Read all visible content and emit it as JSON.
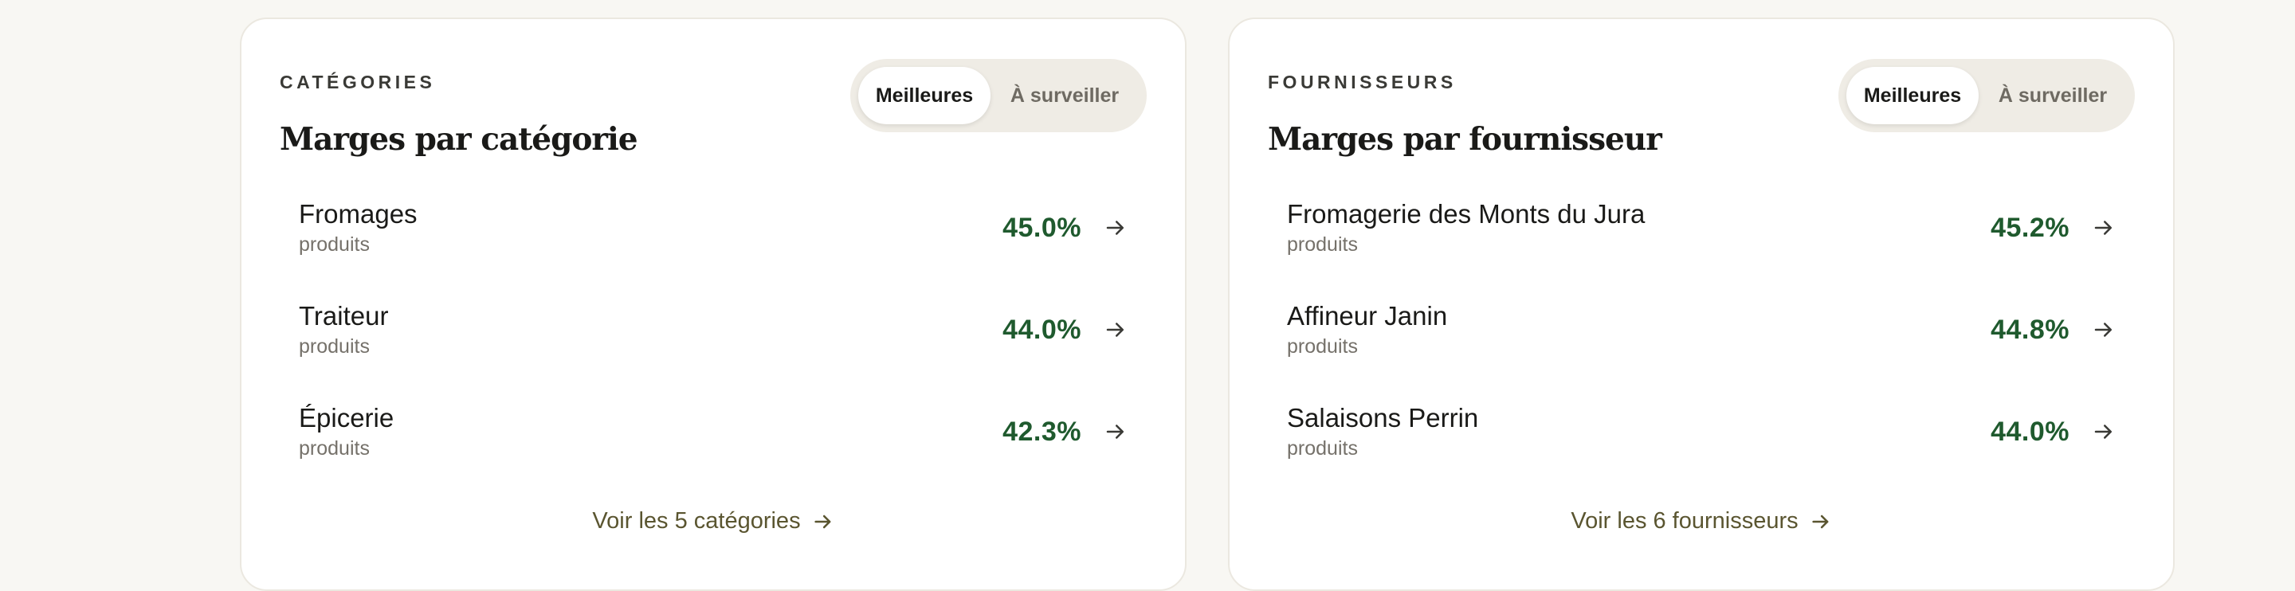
{
  "categories": {
    "eyebrow": "CATÉGORIES",
    "title": "Marges par catégorie",
    "toggle": {
      "active": "Meilleures",
      "inactive": "À surveiller"
    },
    "rows": [
      {
        "name": "Fromages",
        "sub": "produits",
        "value": "45.0%"
      },
      {
        "name": "Traiteur",
        "sub": "produits",
        "value": "44.0%"
      },
      {
        "name": "Épicerie",
        "sub": "produits",
        "value": "42.3%"
      }
    ],
    "footer_link": "Voir les 5 catégories"
  },
  "suppliers": {
    "eyebrow": "FOURNISSEURS",
    "title": "Marges par fournisseur",
    "toggle": {
      "active": "Meilleures",
      "inactive": "À surveiller"
    },
    "rows": [
      {
        "name": "Fromagerie des Monts du Jura",
        "sub": "produits",
        "value": "45.2%"
      },
      {
        "name": "Affineur Janin",
        "sub": "produits",
        "value": "44.8%"
      },
      {
        "name": "Salaisons Perrin",
        "sub": "produits",
        "value": "44.0%"
      }
    ],
    "footer_link": "Voir les 6 fournisseurs"
  },
  "colors": {
    "background": "#f8f7f3",
    "card": "#ffffff",
    "value_green": "#1f5a2e",
    "link_olive": "#5a5530"
  },
  "icons": {
    "row_arrow": "arrow-right-icon",
    "footer_arrow": "arrow-right-icon"
  }
}
